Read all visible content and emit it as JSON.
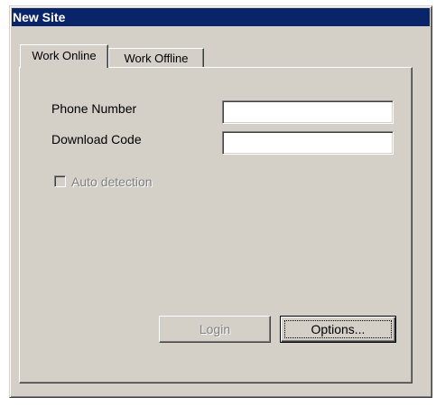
{
  "window": {
    "title": "New Site"
  },
  "tabs": [
    {
      "label": "Work Online",
      "active": true
    },
    {
      "label": "Work Offline",
      "active": false
    }
  ],
  "form": {
    "phone_label": "Phone Number",
    "phone_value": "",
    "download_label": "Download Code",
    "download_value": "",
    "auto_detection_label": "Auto detection",
    "auto_detection_checked": false,
    "auto_detection_enabled": false
  },
  "buttons": {
    "login_label": "Login",
    "login_enabled": false,
    "options_label": "Options..."
  },
  "colors": {
    "face": "#d4d0c8",
    "titlebar": "#0a246a",
    "disabled_text": "#808080"
  }
}
